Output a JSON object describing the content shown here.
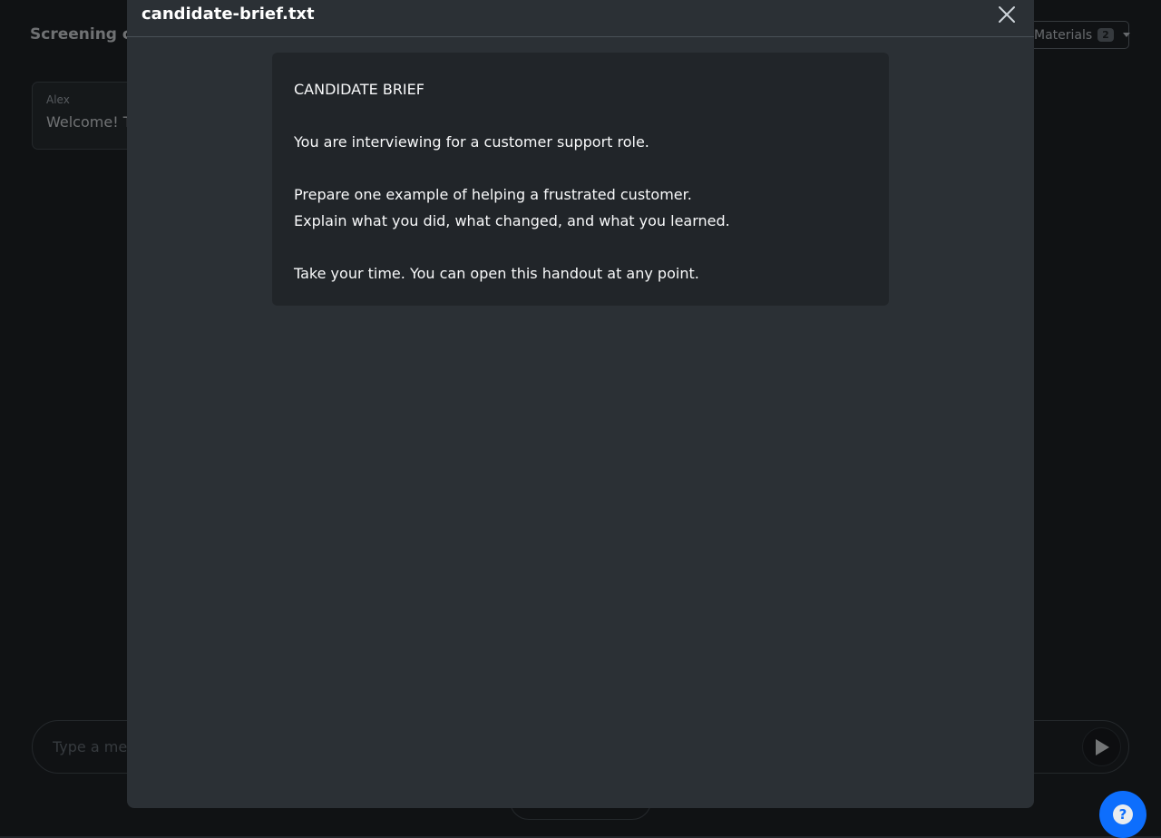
{
  "page": {
    "title": "Screening ca",
    "materials": {
      "label": "Materials",
      "count": "2"
    }
  },
  "chat": {
    "message": {
      "sender": "Alex",
      "text": "Welcome! T"
    }
  },
  "composer": {
    "placeholder": "Type a mes"
  },
  "modal": {
    "title": "candidate-brief.txt",
    "document": {
      "lines": [
        "CANDIDATE BRIEF",
        "",
        "You are interviewing for a customer support role.",
        "",
        "Prepare one example of helping a frustrated customer.",
        "Explain what you did, what changed, and what you learned.",
        "",
        "Take your time. You can open this handout at any point."
      ]
    }
  },
  "icons": {
    "close": "close-icon",
    "send": "play-icon",
    "help": "question-icon",
    "caret": "caret-down-icon"
  },
  "colors": {
    "background": "#212529",
    "modal": "#2b3035",
    "accent": "#0d6efd"
  }
}
